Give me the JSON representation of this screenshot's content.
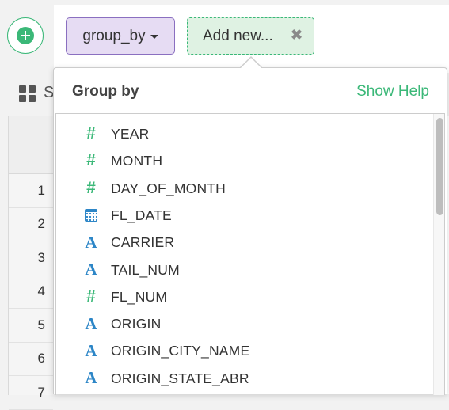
{
  "toolbar": {
    "add_step_icon": "plus-circle-icon",
    "command_label": "group_by",
    "add_new_label": "Add new...",
    "close_icon": "close-x-icon"
  },
  "background": {
    "view_label_partial": "S",
    "row_numbers": [
      "1",
      "2",
      "3",
      "4",
      "5",
      "6",
      "7"
    ]
  },
  "popup": {
    "title": "Group by",
    "help_link": "Show Help",
    "columns": [
      {
        "name": "YEAR",
        "type": "number",
        "icon": "hash-icon"
      },
      {
        "name": "MONTH",
        "type": "number",
        "icon": "hash-icon"
      },
      {
        "name": "DAY_OF_MONTH",
        "type": "number",
        "icon": "hash-icon"
      },
      {
        "name": "FL_DATE",
        "type": "date",
        "icon": "calendar-icon"
      },
      {
        "name": "CARRIER",
        "type": "string",
        "icon": "text-a-icon"
      },
      {
        "name": "TAIL_NUM",
        "type": "string",
        "icon": "text-a-icon"
      },
      {
        "name": "FL_NUM",
        "type": "number",
        "icon": "hash-icon"
      },
      {
        "name": "ORIGIN",
        "type": "string",
        "icon": "text-a-icon"
      },
      {
        "name": "ORIGIN_CITY_NAME",
        "type": "string",
        "icon": "text-a-icon"
      },
      {
        "name": "ORIGIN_STATE_ABR",
        "type": "string",
        "icon": "text-a-icon"
      }
    ]
  },
  "colors": {
    "accent_green": "#3bb878",
    "command_purple": "#8a6fc0",
    "string_blue": "#2d86c7"
  }
}
